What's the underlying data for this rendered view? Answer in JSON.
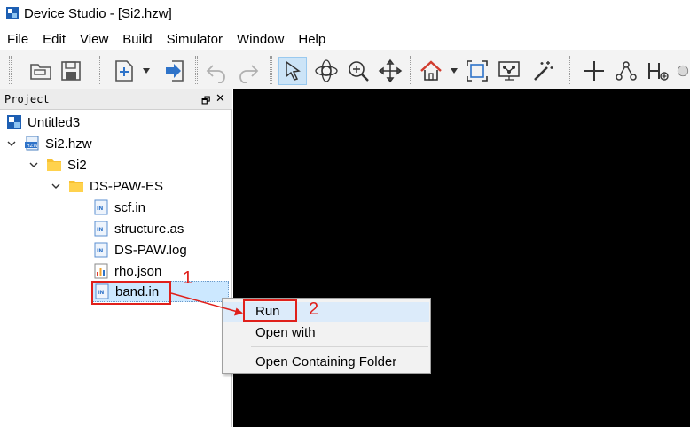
{
  "window": {
    "title": "Device Studio - [Si2.hzw]"
  },
  "menu": {
    "items": [
      "File",
      "Edit",
      "View",
      "Build",
      "Simulator",
      "Window",
      "Help"
    ]
  },
  "toolbar": {
    "buttons": [
      "open-folder-icon",
      "save-icon",
      "new-file-icon",
      "import-icon",
      "undo-icon",
      "redo-icon",
      "select-pointer-icon",
      "rotate-icon",
      "zoom-icon",
      "move-icon",
      "home-view-icon",
      "fit-view-icon",
      "molecule-grid-icon",
      "magic-wand-icon",
      "add-atom-icon",
      "bond-icon",
      "add-hydrogen-icon",
      "sphere-icon"
    ],
    "accent": "#2e73c9"
  },
  "project": {
    "title": "Project",
    "float_glyph": "🗗",
    "close_glyph": "✕",
    "tree": [
      {
        "label": "Untitled3",
        "icon": "project-icon"
      },
      {
        "label": "Si2.hzw",
        "icon": "hzw-file-icon"
      },
      {
        "label": "Si2",
        "icon": "folder-icon"
      },
      {
        "label": "DS-PAW-ES",
        "icon": "folder-icon"
      },
      {
        "label": "scf.in",
        "icon": "in-file-icon"
      },
      {
        "label": "structure.as",
        "icon": "in-file-icon"
      },
      {
        "label": "DS-PAW.log",
        "icon": "in-file-icon"
      },
      {
        "label": "rho.json",
        "icon": "chart-file-icon"
      },
      {
        "label": "band.in",
        "icon": "in-file-icon",
        "selected": true
      }
    ]
  },
  "context_menu": {
    "items": [
      "Run",
      "Open with",
      "Open Containing Folder"
    ]
  },
  "annotations": {
    "label_1": "1",
    "label_2": "2",
    "color": "#e0201b"
  }
}
